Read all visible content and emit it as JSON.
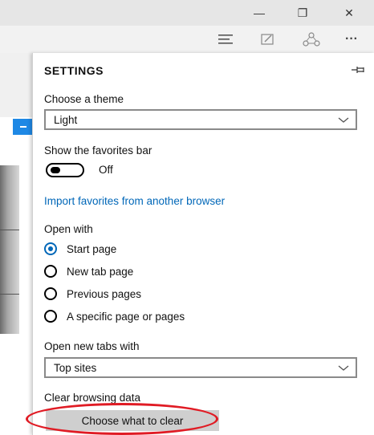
{
  "window": {
    "minimize_glyph": "—",
    "restore_glyph": "❐",
    "close_glyph": "✕"
  },
  "toolbar": {
    "icons": [
      "hub-icon",
      "web-note-icon",
      "share-icon",
      "more-icon"
    ],
    "more_glyph": "···"
  },
  "settings": {
    "title": "SETTINGS",
    "theme": {
      "label": "Choose a theme",
      "value": "Light"
    },
    "favorites_bar": {
      "label": "Show the favorites bar",
      "state": "Off"
    },
    "import_link": "Import favorites from another browser",
    "open_with": {
      "label": "Open with",
      "options": [
        "Start page",
        "New tab page",
        "Previous pages",
        "A specific page or pages"
      ],
      "selected": "Start page"
    },
    "new_tabs": {
      "label": "Open new tabs with",
      "value": "Top sites"
    },
    "clear_data": {
      "label": "Clear browsing data",
      "button": "Choose what to clear"
    }
  },
  "colors": {
    "accent": "#0067b8",
    "highlight_circle": "#e01b24"
  }
}
